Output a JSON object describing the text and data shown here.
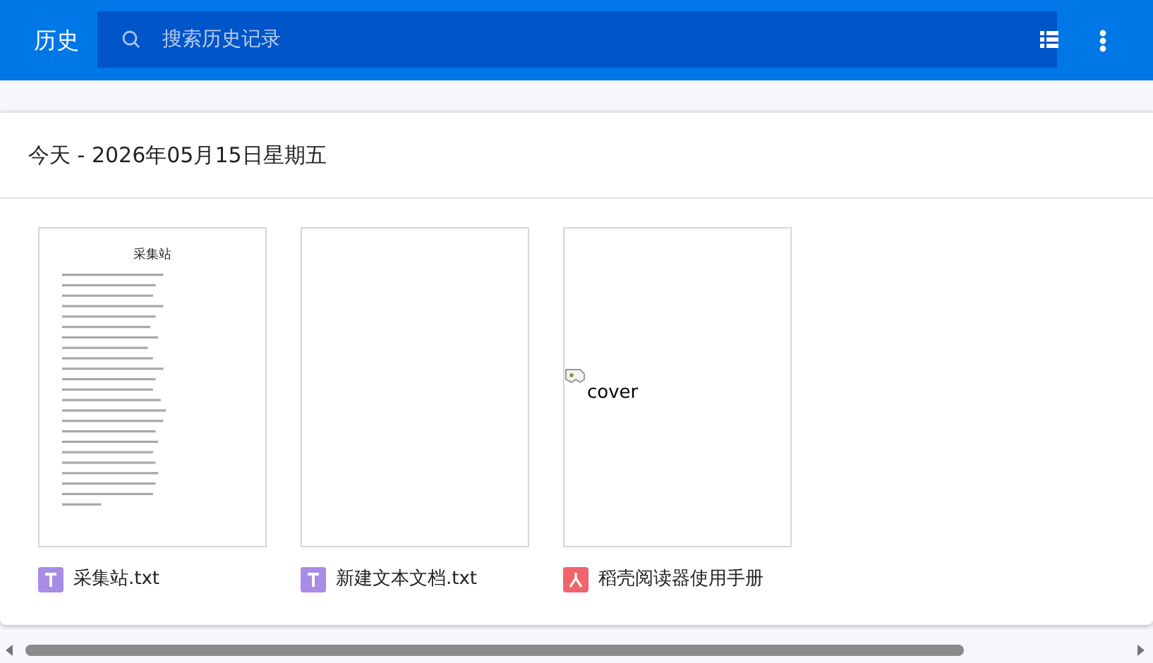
{
  "header": {
    "title": "历史",
    "search": {
      "placeholder": "搜索历史记录"
    }
  },
  "group": {
    "heading": "今天 - 2026年05月15日星期五"
  },
  "files": [
    {
      "name": "采集站.txt",
      "kind": "txt",
      "preview": {
        "kind": "document",
        "title": "采集站"
      }
    },
    {
      "name": "新建文本文档.txt",
      "kind": "txt",
      "preview": {
        "kind": "blank"
      }
    },
    {
      "name": "稻壳阅读器使用手册",
      "kind": "pdf",
      "preview": {
        "kind": "broken",
        "alt": "cover"
      }
    }
  ]
}
